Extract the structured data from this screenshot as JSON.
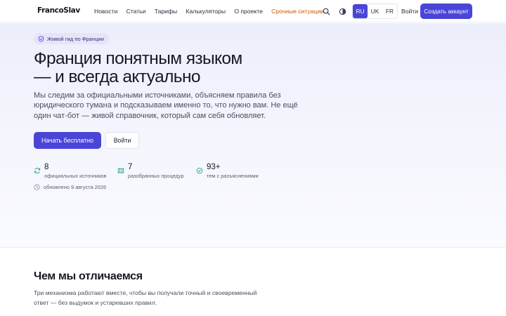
{
  "header": {
    "logo": "FrancoSlav",
    "nav": [
      "Новости",
      "Статьи",
      "Тарифы",
      "Калькуляторы",
      "О проекте"
    ],
    "nav_urgent": "Срочные ситуации",
    "languages": [
      "RU",
      "UK",
      "FR"
    ],
    "active_language": "RU",
    "login_label": "Войти",
    "signup_label": "Создать аккаунт"
  },
  "hero": {
    "badge": "Живой гид по Франции",
    "title_line1": "Франция понятным языком",
    "title_line2": "— и всегда актуально",
    "description": "Мы следим за официальными источниками, объясняем правила без юридического тумана и подсказываем именно то, что нужно вам. Не ещё один чат-бот — живой справочник, который сам себя обновляет.",
    "primary_button": "Начать бесплатно",
    "secondary_button": "Войти",
    "stats": [
      {
        "value": "8",
        "label": "официальных источников",
        "icon": "refresh-icon"
      },
      {
        "value": "7",
        "label": "разобранных процедур",
        "icon": "map-icon"
      },
      {
        "value": "93+",
        "label": "тем с разъяснениями",
        "icon": "check-circle-icon"
      }
    ],
    "updated": "обновлено 9 августа 2026"
  },
  "differences": {
    "title": "Чем мы отличаемся",
    "description": "Три механизма работают вместе, чтобы вы получали точный и своевременный ответ — без выдумок и устаревших правил."
  },
  "colors": {
    "accent": "#4a45d8",
    "urgent": "#c15a11",
    "stat_icon": "#2f9e9a"
  }
}
